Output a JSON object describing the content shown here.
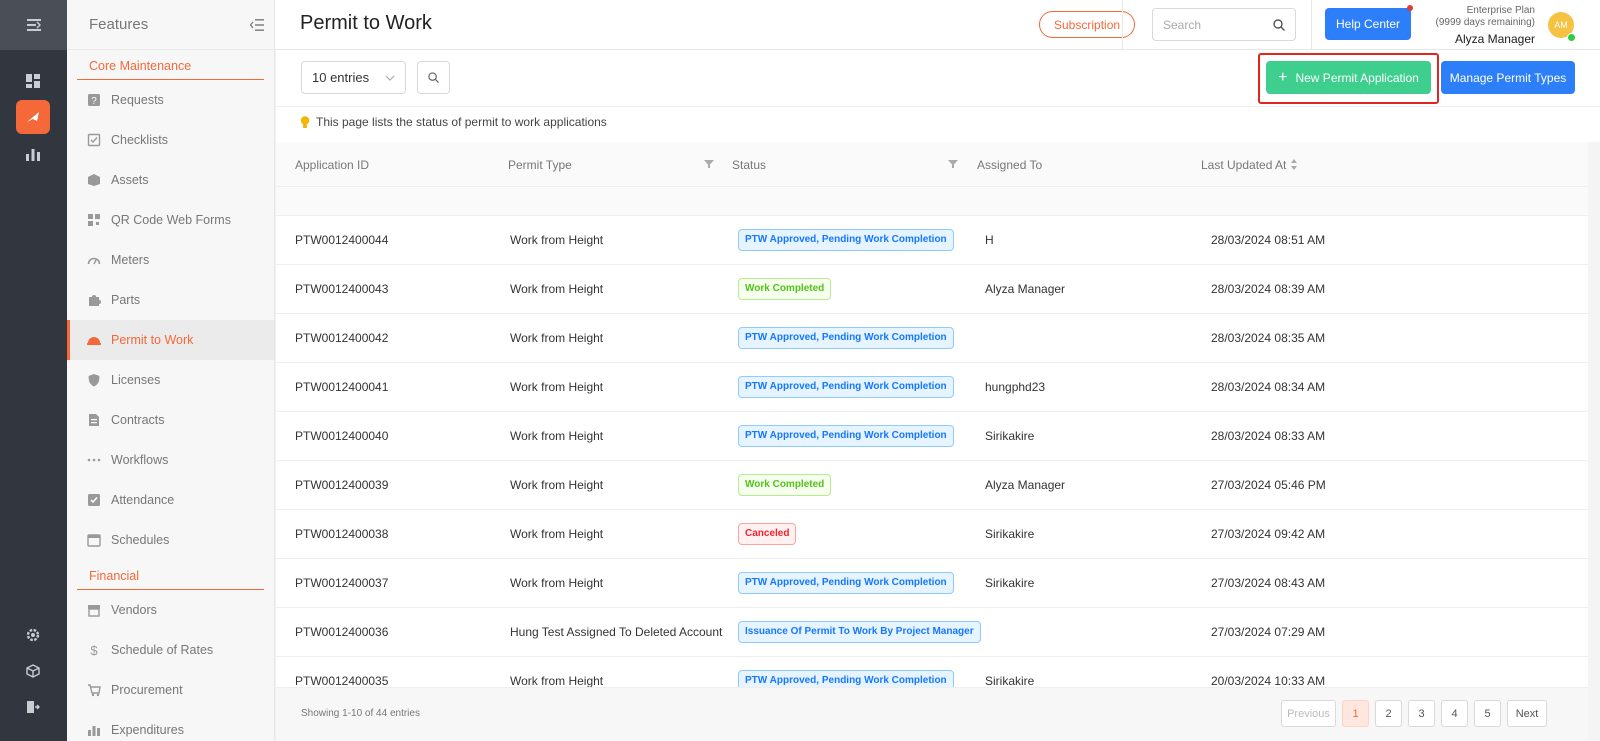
{
  "rail": {
    "icons": [
      "menu-collapse-icon",
      "dashboard-icon",
      "permit-icon",
      "analytics-icon",
      "settings-icon",
      "cube-icon",
      "logout-icon"
    ]
  },
  "sidebar": {
    "title": "Features",
    "sections": [
      {
        "label": "Core Maintenance",
        "items": [
          {
            "label": "Requests",
            "icon": "question-icon"
          },
          {
            "label": "Checklists",
            "icon": "checklist-icon"
          },
          {
            "label": "Assets",
            "icon": "box-icon"
          },
          {
            "label": "QR Code Web Forms",
            "icon": "qr-code-icon"
          },
          {
            "label": "Meters",
            "icon": "gauge-icon"
          },
          {
            "label": "Parts",
            "icon": "puzzle-icon"
          },
          {
            "label": "Permit to Work",
            "icon": "hard-hat-icon",
            "active": true
          },
          {
            "label": "Licenses",
            "icon": "shield-icon"
          },
          {
            "label": "Contracts",
            "icon": "document-icon"
          },
          {
            "label": "Workflows",
            "icon": "dots-icon"
          },
          {
            "label": "Attendance",
            "icon": "check-square-icon"
          },
          {
            "label": "Schedules",
            "icon": "calendar-icon"
          }
        ]
      },
      {
        "label": "Financial",
        "items": [
          {
            "label": "Vendors",
            "icon": "store-icon"
          },
          {
            "label": "Schedule of Rates",
            "icon": "dollar-icon"
          },
          {
            "label": "Procurement",
            "icon": "cart-icon"
          },
          {
            "label": "Expenditures",
            "icon": "chart-icon"
          }
        ]
      }
    ]
  },
  "header": {
    "title": "Permit to Work",
    "subscription_label": "Subscription",
    "search_placeholder": "Search",
    "help_label": "Help Center",
    "plan_name": "Enterprise Plan",
    "plan_remaining": "(9999 days remaining)",
    "user_name": "Alyza Manager",
    "avatar_initials": "AM"
  },
  "toolbar": {
    "entries_value": "10 entries",
    "new_label": "New Permit Application",
    "manage_label": "Manage Permit Types"
  },
  "info_text": "This page lists the status of permit to work applications",
  "table": {
    "columns": [
      "Application ID",
      "Permit Type",
      "Status",
      "Assigned To",
      "Last Updated At"
    ],
    "rows": [
      {
        "id": "PTW0012400044",
        "type": "Work from Height",
        "status": "PTW Approved, Pending Work Completion",
        "status_color": "blue",
        "assigned": "H",
        "updated": "28/03/2024 08:51 AM"
      },
      {
        "id": "PTW0012400043",
        "type": "Work from Height",
        "status": "Work Completed",
        "status_color": "green",
        "assigned": "Alyza Manager",
        "updated": "28/03/2024 08:39 AM"
      },
      {
        "id": "PTW0012400042",
        "type": "Work from Height",
        "status": "PTW Approved, Pending Work Completion",
        "status_color": "blue",
        "assigned": "",
        "updated": "28/03/2024 08:35 AM"
      },
      {
        "id": "PTW0012400041",
        "type": "Work from Height",
        "status": "PTW Approved, Pending Work Completion",
        "status_color": "blue",
        "assigned": "hungphd23",
        "updated": "28/03/2024 08:34 AM"
      },
      {
        "id": "PTW0012400040",
        "type": "Work from Height",
        "status": "PTW Approved, Pending Work Completion",
        "status_color": "blue",
        "assigned": "Sirikakire",
        "updated": "28/03/2024 08:33 AM"
      },
      {
        "id": "PTW0012400039",
        "type": "Work from Height",
        "status": "Work Completed",
        "status_color": "green",
        "assigned": "Alyza Manager",
        "updated": "27/03/2024 05:46 PM"
      },
      {
        "id": "PTW0012400038",
        "type": "Work from Height",
        "status": "Canceled",
        "status_color": "red",
        "assigned": "Sirikakire",
        "updated": "27/03/2024 09:42 AM"
      },
      {
        "id": "PTW0012400037",
        "type": "Work from Height",
        "status": "PTW Approved, Pending Work Completion",
        "status_color": "blue",
        "assigned": "Sirikakire",
        "updated": "27/03/2024 08:43 AM"
      },
      {
        "id": "PTW0012400036",
        "type": "Hung Test Assigned To Deleted Account",
        "status": "Issuance Of Permit To Work By Project Manager",
        "status_color": "blue",
        "assigned": "",
        "updated": "27/03/2024 07:29 AM"
      },
      {
        "id": "PTW0012400035",
        "type": "Work from Height",
        "status": "PTW Approved, Pending Work Completion",
        "status_color": "blue",
        "assigned": "Sirikakire",
        "updated": "20/03/2024 10:33 AM"
      }
    ]
  },
  "footer": {
    "showing": "Showing 1-10 of 44 entries",
    "previous": "Previous",
    "pages": [
      "1",
      "2",
      "3",
      "4",
      "5"
    ],
    "current_page": "1",
    "next": "Next"
  },
  "colors": {
    "accent": "#f4683a",
    "primary": "#2d7ff9",
    "success": "#3ecf8e",
    "highlight_box": "#e0261f",
    "rail_bg": "#32373f"
  }
}
